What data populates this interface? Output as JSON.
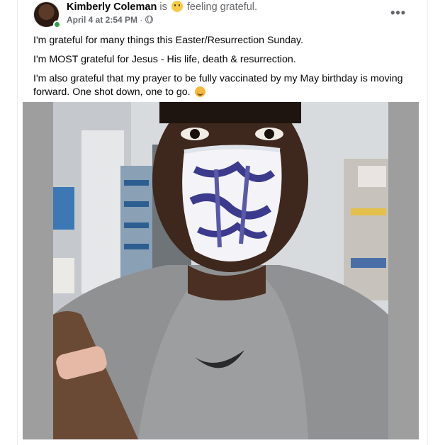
{
  "post": {
    "author": "Kimberly Coleman",
    "is_text": "is",
    "feeling_text": "feeling grateful.",
    "feeling_icon": "grateful-face-icon",
    "date": "April 4 at 2:54 PM",
    "separator": "·",
    "audience_icon": "globe-icon",
    "more_label": "•••",
    "paragraphs": [
      "I'm grateful for many things this Easter/Resurrection Sunday.",
      "I'm MOST grateful for Jesus - His life, death & resurrection.",
      "I'm also grateful that my prayer to be fully vaccinated by my May birthday is moving forward. One shot down, one to go."
    ],
    "end_emoji": "smiling-face-icon"
  },
  "colors": {
    "online": "#31a24c",
    "muted_text": "#65676b",
    "photo_frame": "#9e9e9e"
  }
}
